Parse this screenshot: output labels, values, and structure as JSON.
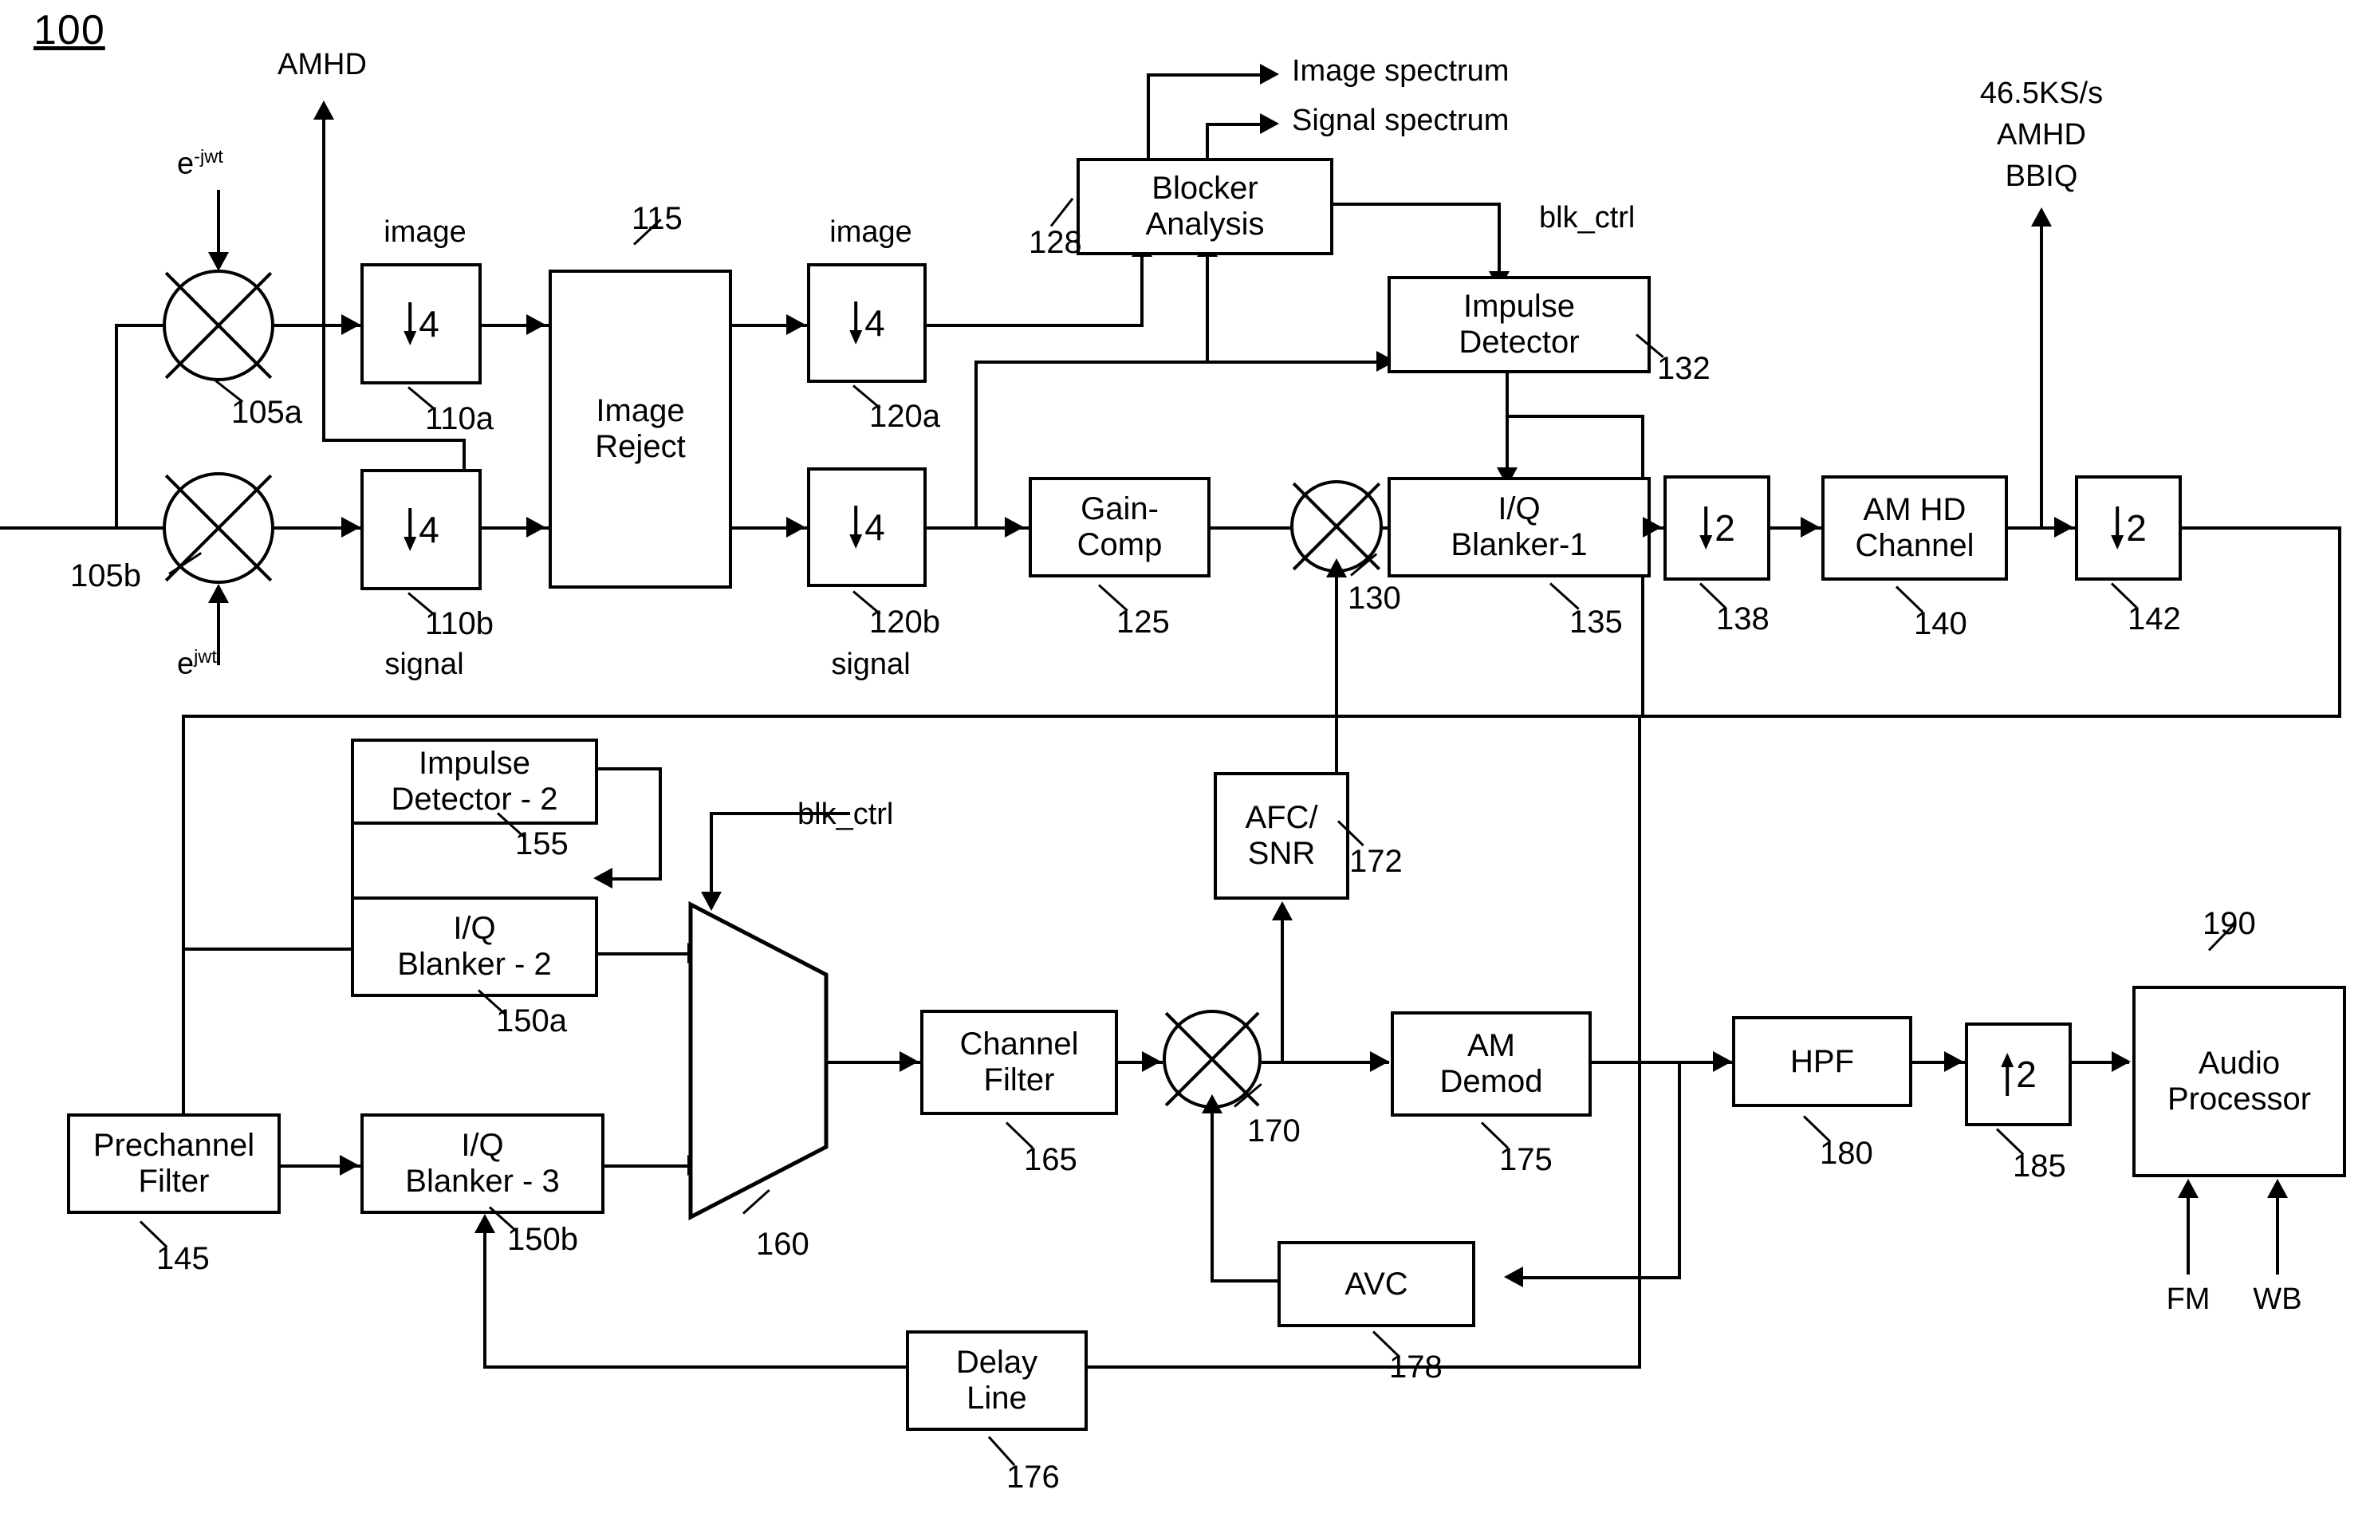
{
  "figure": {
    "number": "100"
  },
  "signals": {
    "lo_upper": "e",
    "lo_upper_exp": "-jwt",
    "lo_lower": "e",
    "lo_lower_exp": "jwt",
    "amhd_tap": "AMHD",
    "image_upper": "image",
    "signal_lower": "signal",
    "image_mid": "image",
    "signal_mid": "signal",
    "image_spectrum": "Image spectrum",
    "signal_spectrum": "Signal spectrum",
    "blk_ctrl_top": "blk_ctrl",
    "blk_ctrl_bottom": "blk_ctrl",
    "output_rate": "46.5KS/s",
    "output_name": "AMHD",
    "output_format": "BBIQ",
    "fm_input": "FM",
    "wb_input": "WB"
  },
  "blocks": {
    "mixer_a": {
      "label": "",
      "ref": "105a"
    },
    "mixer_b": {
      "label": "",
      "ref": "105b"
    },
    "dec4_a": {
      "factor": "4",
      "ref": "110a"
    },
    "dec4_b": {
      "factor": "4",
      "ref": "110b"
    },
    "image_reject": {
      "line1": "Image",
      "line2": "Reject",
      "ref": "115"
    },
    "dec4_c": {
      "factor": "4",
      "ref": "120a"
    },
    "dec4_d": {
      "factor": "4",
      "ref": "120b"
    },
    "gain_comp": {
      "line1": "Gain-",
      "line2": "Comp",
      "ref": "125"
    },
    "blocker_analysis": {
      "line1": "Blocker",
      "line2": "Analysis",
      "ref": "128"
    },
    "mixer_c": {
      "label": "",
      "ref": "130"
    },
    "impulse_detector": {
      "line1": "Impulse",
      "line2": "Detector",
      "ref": "132"
    },
    "iq_blanker_1": {
      "line1": "I/Q",
      "line2": "Blanker-1",
      "ref": "135"
    },
    "dec2_a": {
      "factor": "2",
      "ref": "138"
    },
    "am_hd_channel": {
      "line1": "AM HD",
      "line2": "Channel",
      "ref": "140"
    },
    "dec2_b": {
      "factor": "2",
      "ref": "142"
    },
    "prechannel_filter": {
      "line1": "Prechannel",
      "line2": "Filter",
      "ref": "145"
    },
    "iq_blanker_2": {
      "line1": "I/Q",
      "line2": "Blanker - 2",
      "ref": "150a"
    },
    "iq_blanker_3": {
      "line1": "I/Q",
      "line2": "Blanker - 3",
      "ref": "150b"
    },
    "impulse_detector_2": {
      "line1": "Impulse",
      "line2": "Detector - 2",
      "ref": "155"
    },
    "mux": {
      "label": "",
      "ref": "160"
    },
    "channel_filter": {
      "line1": "Channel",
      "line2": "Filter",
      "ref": "165"
    },
    "mixer_d": {
      "label": "",
      "ref": "170"
    },
    "afc_snr": {
      "line1": "AFC/",
      "line2": "SNR",
      "ref": "172"
    },
    "am_demod": {
      "line1": "AM",
      "line2": "Demod",
      "ref": "175"
    },
    "delay_line": {
      "line1": "Delay",
      "line2": "Line",
      "ref": "176"
    },
    "avc": {
      "line1": "AVC",
      "line2": "",
      "ref": "178"
    },
    "hpf": {
      "line1": "HPF",
      "line2": "",
      "ref": "180"
    },
    "int2": {
      "factor": "2",
      "ref": "185"
    },
    "audio_processor": {
      "line1": "Audio",
      "line2": "Processor",
      "ref": "190"
    }
  },
  "colors": {
    "ink": "#000000",
    "paper": "#ffffff"
  }
}
